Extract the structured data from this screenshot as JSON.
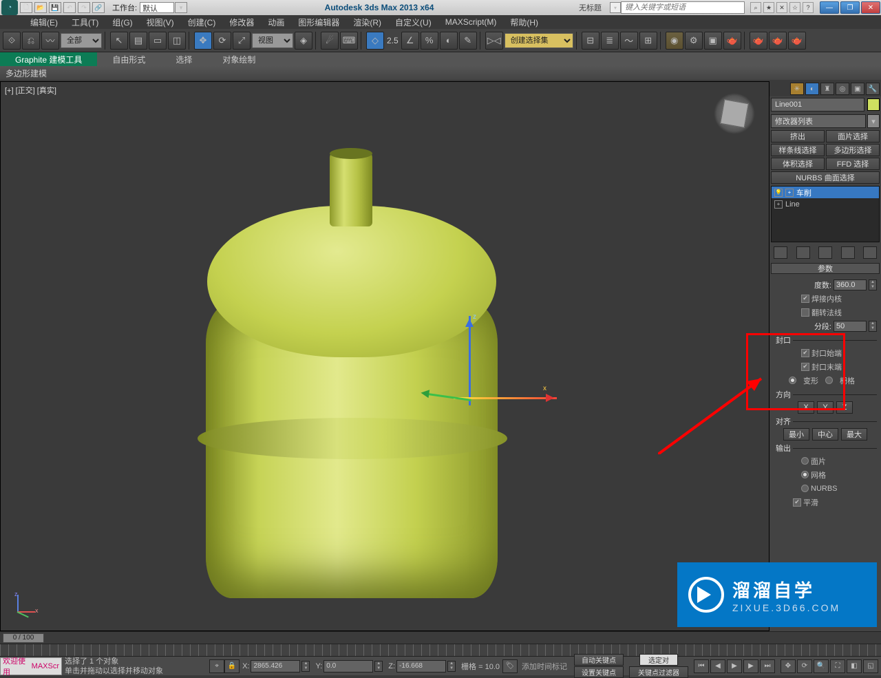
{
  "titlebar": {
    "workspace_label": "工作台:",
    "workspace_value": "默认",
    "app_title": "Autodesk 3ds Max  2013 x64",
    "doc_title": "无标题",
    "search_placeholder": "键入关键字或短语"
  },
  "menu": {
    "edit": "编辑(E)",
    "tools": "工具(T)",
    "group": "组(G)",
    "views": "视图(V)",
    "create": "创建(C)",
    "modifiers": "修改器",
    "animation": "动画",
    "graph": "图形编辑器",
    "render": "渲染(R)",
    "customize": "自定义(U)",
    "maxscript": "MAXScript(M)",
    "help": "帮助(H)"
  },
  "maintb": {
    "sel_filter": "全部",
    "ref_coord": "视图",
    "angle_snap": "2.5",
    "named_sel": "创建选择集"
  },
  "ribbon": {
    "t1": "Graphite 建模工具",
    "t2": "自由形式",
    "t3": "选择",
    "t4": "对象绘制",
    "sub": "多边形建模"
  },
  "viewport": {
    "label": "[+] [正交] [真实]"
  },
  "rpanel": {
    "object_name": "Line001",
    "mod_list_dd": "修改器列表",
    "btns": {
      "extrude": "挤出",
      "patch_sel": "面片选择",
      "spline_sel": "样条线选择",
      "poly_sel": "多边形选择",
      "vol_sel": "体积选择",
      "ffd_sel": "FFD 选择",
      "nurbs_sel": "NURBS 曲面选择"
    },
    "stack": {
      "item1": "车削",
      "item2": "Line"
    },
    "rollout_title": "参数",
    "params": {
      "degrees_lbl": "度数:",
      "degrees_val": "360.0",
      "weld_core": "焊接内核",
      "flip_normals": "翻转法线",
      "segments_lbl": "分段:",
      "segments_val": "50",
      "cap_title": "封口",
      "cap_start": "封口始端",
      "cap_end": "封口末端",
      "morph": "变形",
      "grid": "栅格",
      "dir_title": "方向",
      "x": "X",
      "y": "Y",
      "z": "Z",
      "align_title": "对齐",
      "min": "最小",
      "center": "中心",
      "max": "最大",
      "output_title": "输出",
      "patch": "面片",
      "mesh": "网格",
      "nurbs": "NURBS",
      "smooth": "平滑"
    }
  },
  "timeline": {
    "thumb": "0 / 100"
  },
  "status": {
    "welcome": "欢迎使用",
    "maxscr": "MAXScr",
    "sel": "选择了 1 个对象",
    "hint": "单击并拖动以选择并移动对象",
    "x_lbl": "X:",
    "x_val": "2865.426",
    "y_lbl": "Y:",
    "y_val": "0.0",
    "z_lbl": "Z:",
    "z_val": "-16.668",
    "grid": "栅格 = 10.0",
    "autokey": "自动关键点",
    "selset": "选定对",
    "setkey": "设置关键点",
    "keyfilter": "关键点过滤器",
    "addtime": "添加时间标记"
  },
  "watermark": {
    "name": "溜溜自学",
    "url": "ZIXUE.3D66.COM"
  }
}
